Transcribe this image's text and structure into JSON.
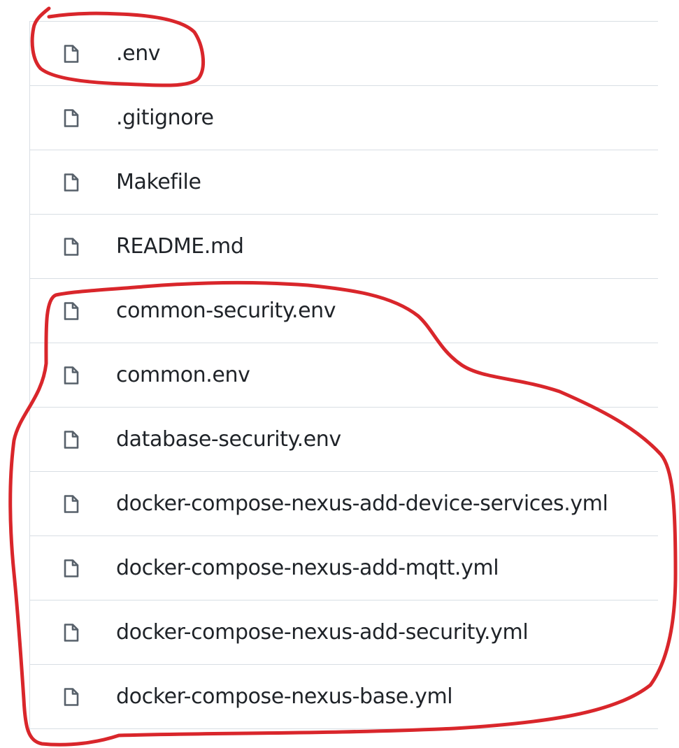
{
  "file_list": {
    "icon_name": "file-icon",
    "items": [
      {
        "name": ".env"
      },
      {
        "name": ".gitignore"
      },
      {
        "name": "Makefile"
      },
      {
        "name": "README.md"
      },
      {
        "name": "common-security.env"
      },
      {
        "name": "common.env"
      },
      {
        "name": "database-security.env"
      },
      {
        "name": "docker-compose-nexus-add-device-services.yml"
      },
      {
        "name": "docker-compose-nexus-add-mqtt.yml"
      },
      {
        "name": "docker-compose-nexus-add-security.yml"
      },
      {
        "name": "docker-compose-nexus-base.yml"
      }
    ]
  },
  "colors": {
    "text": "#1f2328",
    "border": "#d8dee4",
    "icon": "#57606a",
    "annotation": "#d9262b"
  }
}
